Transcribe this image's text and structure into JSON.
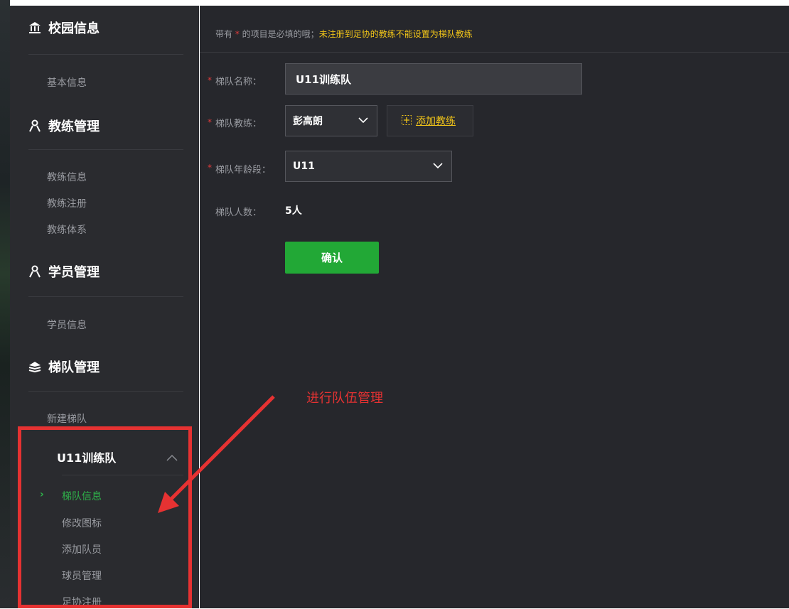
{
  "sidebar": {
    "campus": {
      "title": "校园信息",
      "icon": "bank-icon",
      "items": [
        "基本信息"
      ]
    },
    "coach": {
      "title": "教练管理",
      "icon": "user-icon",
      "items": [
        "教练信息",
        "教练注册",
        "教练体系"
      ]
    },
    "student": {
      "title": "学员管理",
      "icon": "user-icon",
      "items": [
        "学员信息"
      ]
    },
    "team": {
      "title": "梯队管理",
      "icon": "layers-icon",
      "items": [
        "新建梯队"
      ],
      "current_team": "U11训练队",
      "sub_items": [
        "梯队信息",
        "修改图标",
        "添加队员",
        "球员管理",
        "足协注册"
      ],
      "active_sub": "梯队信息"
    }
  },
  "notice": {
    "prefix": "带有",
    "star": "*",
    "middle": "的项目是必填的哦；",
    "warning": "未注册到足协的教练不能设置为梯队教练"
  },
  "form": {
    "name_label": "梯队名称：",
    "name_value": "U11训练队",
    "coach_label": "梯队教练：",
    "coach_value": "彭高朗",
    "add_coach_label": "添加教练",
    "age_label": "梯队年龄段：",
    "age_value": "U11",
    "count_label": "梯队人数：",
    "count_value": "5人",
    "required_mark": "*",
    "confirm_label": "确认"
  },
  "annotation": {
    "text": "进行队伍管理",
    "color": "#e63232"
  },
  "colors": {
    "accent_green": "#22a836",
    "warning_yellow": "#f0c419",
    "required_red": "#e23b3b"
  }
}
